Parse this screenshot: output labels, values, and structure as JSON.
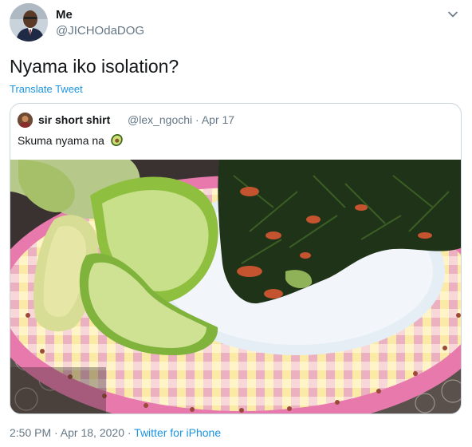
{
  "tweet": {
    "author_name": "Me",
    "author_handle": "@JICHOdaDOG",
    "text": "Nyama iko isolation?",
    "translate_label": "Translate Tweet",
    "time": "2:50 PM · Apr 18, 2020 · ",
    "source": "Twitter for iPhone"
  },
  "quoted": {
    "author_name": "sir short shirt",
    "author_handle": "@lex_ngochi",
    "date": "· Apr 17",
    "text": "Skuma nyama na"
  },
  "icons": {
    "header_menu": "chevron-down-icon",
    "emoji": "avocado-emoji"
  },
  "colors": {
    "link": "#1b95e0",
    "secondary": "#657786",
    "border": "#ccd6dd"
  }
}
